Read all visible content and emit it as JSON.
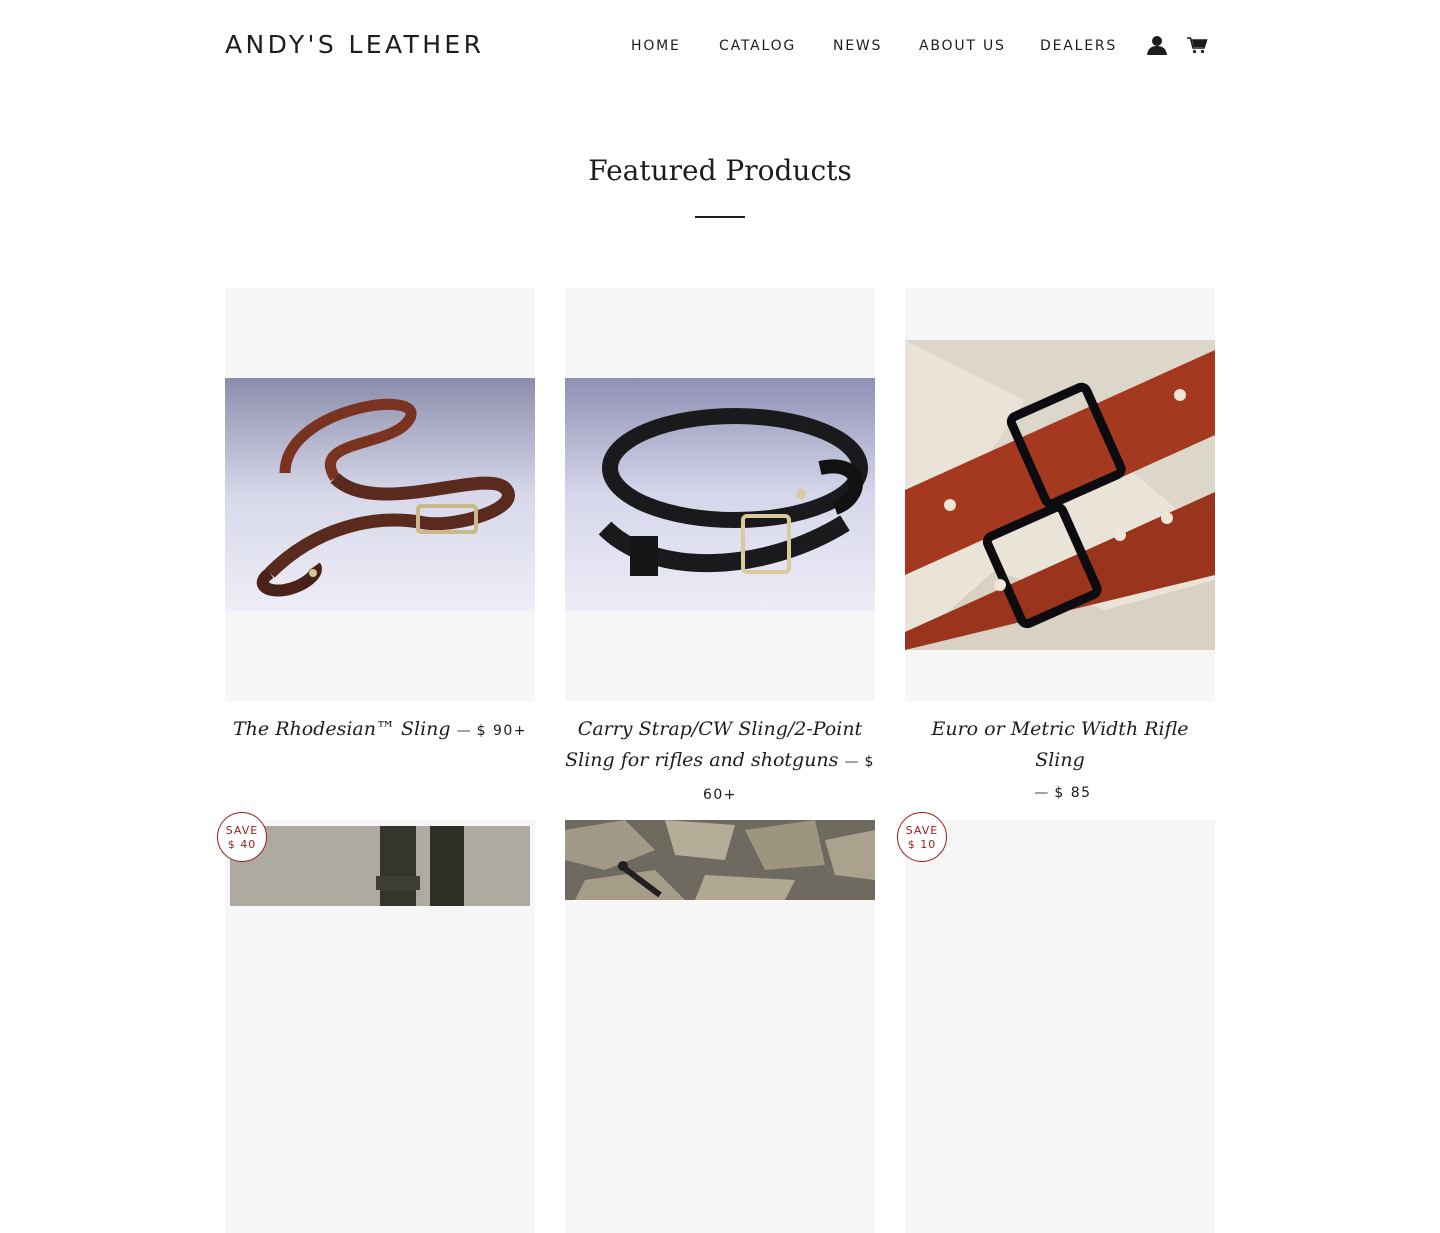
{
  "header": {
    "logo": "ANDY'S LEATHER",
    "nav": [
      "HOME",
      "CATALOG",
      "NEWS",
      "ABOUT US",
      "DEALERS"
    ],
    "account_icon": "account-icon",
    "cart_icon": "cart-icon"
  },
  "featured": {
    "title": "Featured Products",
    "products": [
      {
        "name": "The Rhodesian™ Sling",
        "dash": "—",
        "price": "$ 90+"
      },
      {
        "name": "Carry Strap/CW Sling/2-Point Sling for rifles and shotguns",
        "dash": "—",
        "price": "$ 60+"
      },
      {
        "name": "Euro or Metric Width Rifle Sling",
        "dash": "—",
        "price": "$ 85"
      }
    ],
    "row2": [
      {
        "save_label": "SAVE",
        "save_amount": "$ 40"
      },
      {},
      {
        "save_label": "SAVE",
        "save_amount": "$ 10"
      }
    ]
  },
  "colors": {
    "text": "#1c1d1d",
    "sale": "#9c1c1c",
    "card_bg": "#f6f6f6",
    "leather_brown": "#7a3320",
    "leather_black": "#1a1a1c"
  }
}
